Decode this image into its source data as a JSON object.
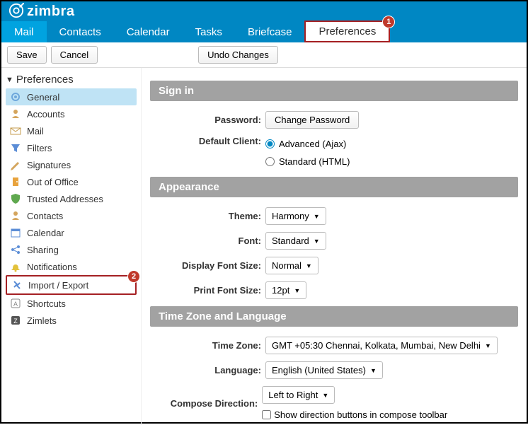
{
  "brand": {
    "name": "zimbra"
  },
  "tabs": {
    "mail": "Mail",
    "contacts": "Contacts",
    "calendar": "Calendar",
    "tasks": "Tasks",
    "briefcase": "Briefcase",
    "preferences": "Preferences"
  },
  "annotations": {
    "badge1": "1",
    "badge2": "2"
  },
  "toolbar": {
    "save": "Save",
    "cancel": "Cancel",
    "undo": "Undo Changes"
  },
  "sidebar": {
    "title": "Preferences",
    "items": [
      {
        "label": "General"
      },
      {
        "label": "Accounts"
      },
      {
        "label": "Mail"
      },
      {
        "label": "Filters"
      },
      {
        "label": "Signatures"
      },
      {
        "label": "Out of Office"
      },
      {
        "label": "Trusted Addresses"
      },
      {
        "label": "Contacts"
      },
      {
        "label": "Calendar"
      },
      {
        "label": "Sharing"
      },
      {
        "label": "Notifications"
      },
      {
        "label": "Import / Export"
      },
      {
        "label": "Shortcuts"
      },
      {
        "label": "Zimlets"
      }
    ]
  },
  "sections": {
    "signin": {
      "title": "Sign in",
      "password_label": "Password:",
      "change_password_btn": "Change Password",
      "default_client_label": "Default Client:",
      "advanced": "Advanced (Ajax)",
      "standard": "Standard (HTML)"
    },
    "appearance": {
      "title": "Appearance",
      "theme_label": "Theme:",
      "theme_value": "Harmony",
      "font_label": "Font:",
      "font_value": "Standard",
      "display_font_size_label": "Display Font Size:",
      "display_font_size_value": "Normal",
      "print_font_size_label": "Print Font Size:",
      "print_font_size_value": "12pt"
    },
    "tz": {
      "title": "Time Zone and Language",
      "tz_label": "Time Zone:",
      "tz_value": "GMT +05:30 Chennai, Kolkata, Mumbai, New Delhi",
      "language_label": "Language:",
      "language_value": "English (United States)",
      "compose_dir_label": "Compose Direction:",
      "compose_dir_value": "Left to Right",
      "show_direction_checkbox": "Show direction buttons in compose toolbar"
    }
  }
}
